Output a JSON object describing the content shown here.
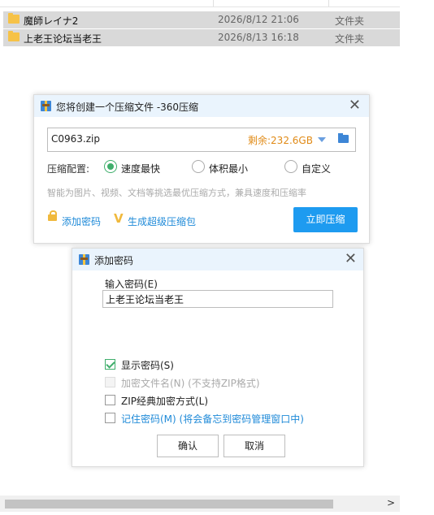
{
  "file_list": {
    "rows": [
      {
        "name": "魔師レイナ2",
        "date": "2026/8/12 21:06",
        "type": "文件夹"
      },
      {
        "name": "上老王论坛当老王",
        "date": "2026/8/13 16:18",
        "type": "文件夹"
      }
    ]
  },
  "compress_dialog": {
    "title": "您将创建一个压缩文件 -360压缩",
    "filename": "C0963.zip",
    "free_space": "剩余:232.6GB",
    "config_label": "压缩配置:",
    "options": [
      "速度最快",
      "体积最小",
      "自定义"
    ],
    "selected_option": "速度最快",
    "hint": "智能为图片、视频、文档等挑选最优压缩方式，兼具速度和压缩率",
    "add_password": "添加密码",
    "super_compress": "生成超级压缩包",
    "compress_button": "立即压缩"
  },
  "password_dialog": {
    "title": "添加密码",
    "input_label": "输入密码(E)",
    "password_value": "上老王论坛当老王",
    "checkboxes": [
      {
        "label": "显示密码(S)",
        "checked": true,
        "disabled": false
      },
      {
        "label": "加密文件名(N) (不支持ZIP格式)",
        "checked": false,
        "disabled": true
      },
      {
        "label": "ZIP经典加密方式(L)",
        "checked": false,
        "disabled": false
      },
      {
        "label": "记住密码(M) (将会备忘到密码管理窗口中)",
        "checked": false,
        "disabled": false
      }
    ],
    "ok_button": "确认",
    "cancel_button": "取消"
  },
  "colors": {
    "accent": "#1e9bf0",
    "selected_radio": "#3fae6b",
    "free_space": "#e08a16"
  }
}
